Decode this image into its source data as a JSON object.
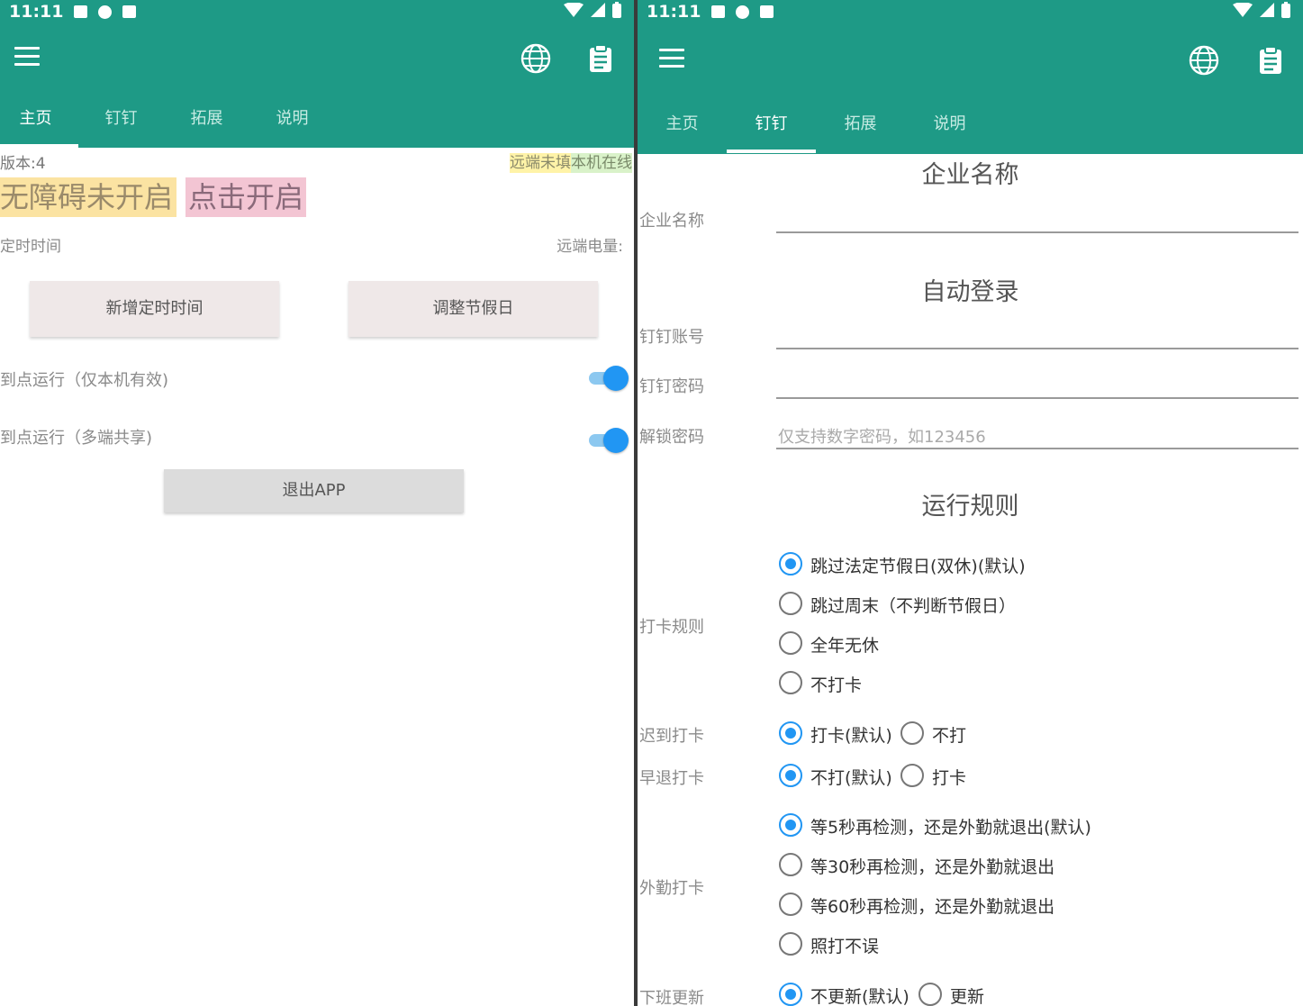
{
  "status_time": "11:11",
  "tabs": [
    "主页",
    "钉钉",
    "拓展",
    "说明"
  ],
  "colors": {
    "accent": "#1e9a86",
    "switch_on": "#2196f3",
    "banner_yellow": "#fbe3a2",
    "banner_pink": "#f3c5d3"
  },
  "icons": [
    "menu-icon",
    "globe-icon",
    "clipboard-icon"
  ],
  "home": {
    "version": "版本:4",
    "remote_status": "远端未填",
    "local_status": "本机在线",
    "accessibility_off": "无障碍未开启",
    "click_enable": "点击开启",
    "timer_label": "定时时间",
    "remote_battery": "远端电量:",
    "add_timer_button": "新增定时时间",
    "adjust_holiday_button": "调整节假日",
    "run_local": "到点运行（仅本机有效)",
    "run_shared": "到点运行（多端共享)",
    "exit_button": "退出APP"
  },
  "dingding": {
    "company_section": "企业名称",
    "company_label": "企业名称",
    "autologin_section": "自动登录",
    "account_label": "钉钉账号",
    "password_label": "钉钉密码",
    "unlock_label": "解锁密码",
    "unlock_placeholder": "仅支持数字密码，如123456",
    "rules_section": "运行规则",
    "punch_rule_label": "打卡规则",
    "punch_rule_options": [
      "跳过法定节假日(双休)(默认)",
      "跳过周末（不判断节假日）",
      "全年无休",
      "不打卡"
    ],
    "late_label": "迟到打卡",
    "late_options": [
      "打卡(默认)",
      "不打"
    ],
    "early_label": "早退打卡",
    "early_options": [
      "不打(默认)",
      "打卡"
    ],
    "field_label": "外勤打卡",
    "field_options": [
      "等5秒再检测，还是外勤就退出(默认)",
      "等30秒再检测，还是外勤就退出",
      "等60秒再检测，还是外勤就退出",
      "照打不误"
    ],
    "offwork_label": "下班更新",
    "offwork_options": [
      "不更新(默认)",
      "更新"
    ]
  }
}
